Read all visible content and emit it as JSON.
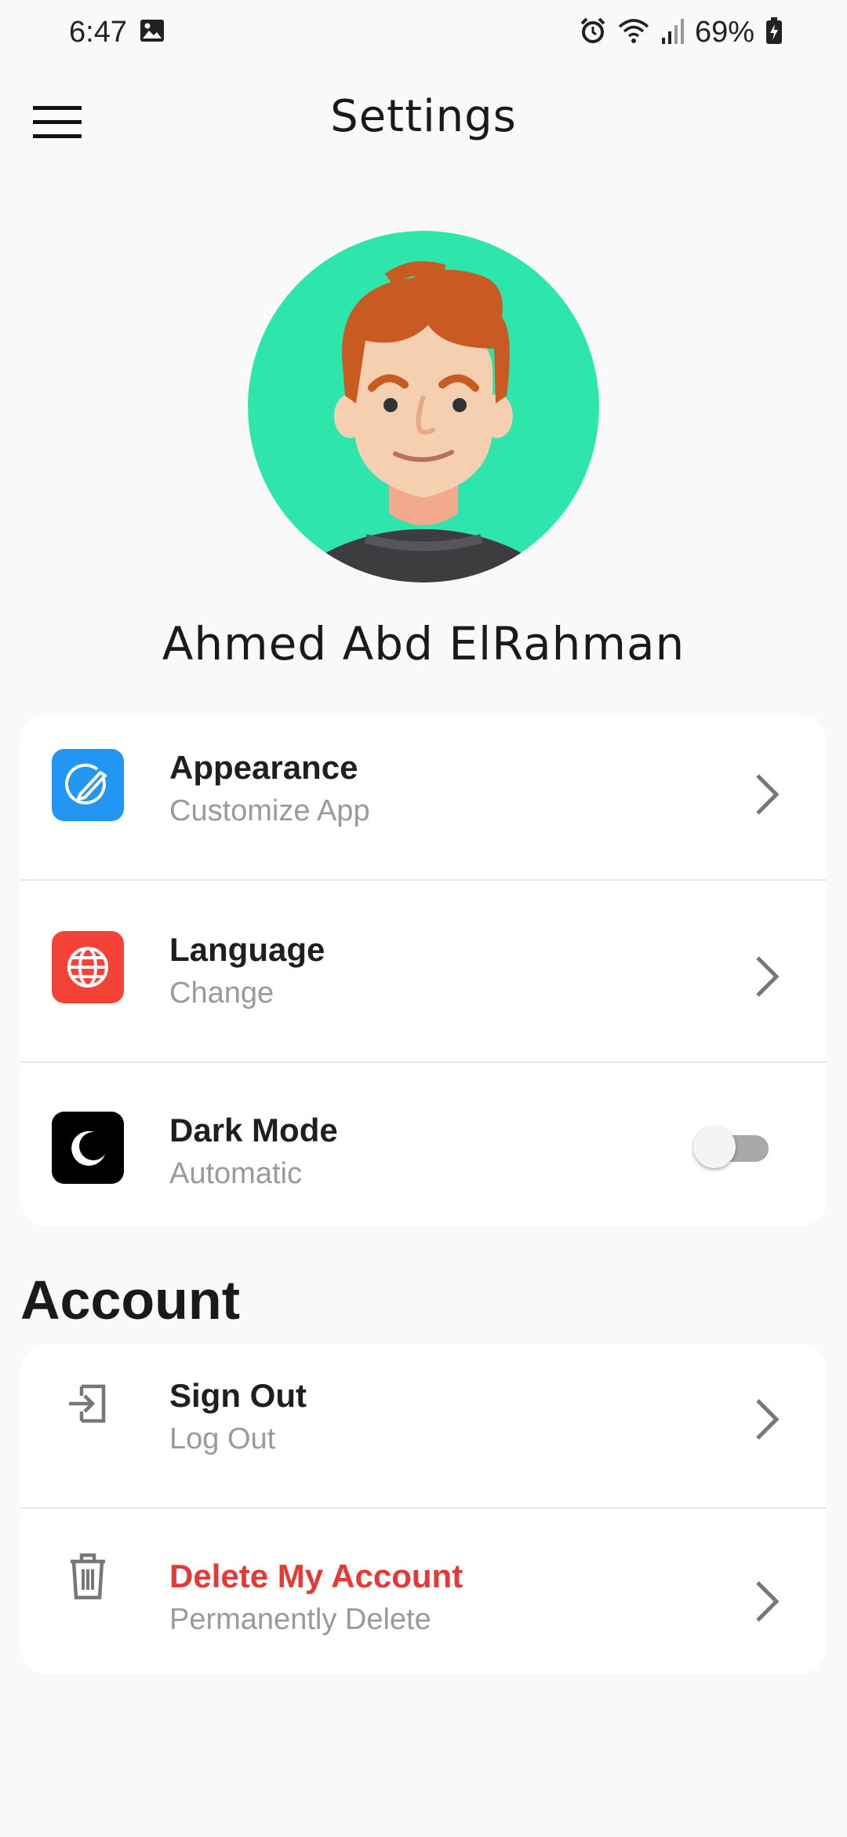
{
  "status_bar": {
    "time": "6:47",
    "battery": "69%",
    "icons": [
      "image-icon",
      "alarm-icon",
      "wifi-icon",
      "signal-icon",
      "battery-charging-icon"
    ]
  },
  "app_bar": {
    "title": "Settings",
    "menu_icon": "hamburger-menu-icon"
  },
  "profile": {
    "name": "Ahmed Abd ElRahman",
    "avatar_bg": "#2ee5ac"
  },
  "preferences": [
    {
      "title": "Appearance",
      "subtitle": "Customize App",
      "icon": "edit-circle-icon",
      "icon_bg": "#2196f3"
    },
    {
      "title": "Language",
      "subtitle": "Change",
      "icon": "globe-icon",
      "icon_bg": "#f44336"
    },
    {
      "title": "Dark Mode",
      "subtitle": "Automatic",
      "icon": "moon-icon",
      "icon_bg": "#000000",
      "toggle_on": false
    }
  ],
  "account": {
    "heading": "Account",
    "items": [
      {
        "title": "Sign Out",
        "subtitle": "Log Out",
        "icon": "sign-out-icon"
      },
      {
        "title": "Delete My Account",
        "subtitle": "Permanently Delete",
        "icon": "trash-icon",
        "title_color": "#e53935"
      }
    ]
  }
}
